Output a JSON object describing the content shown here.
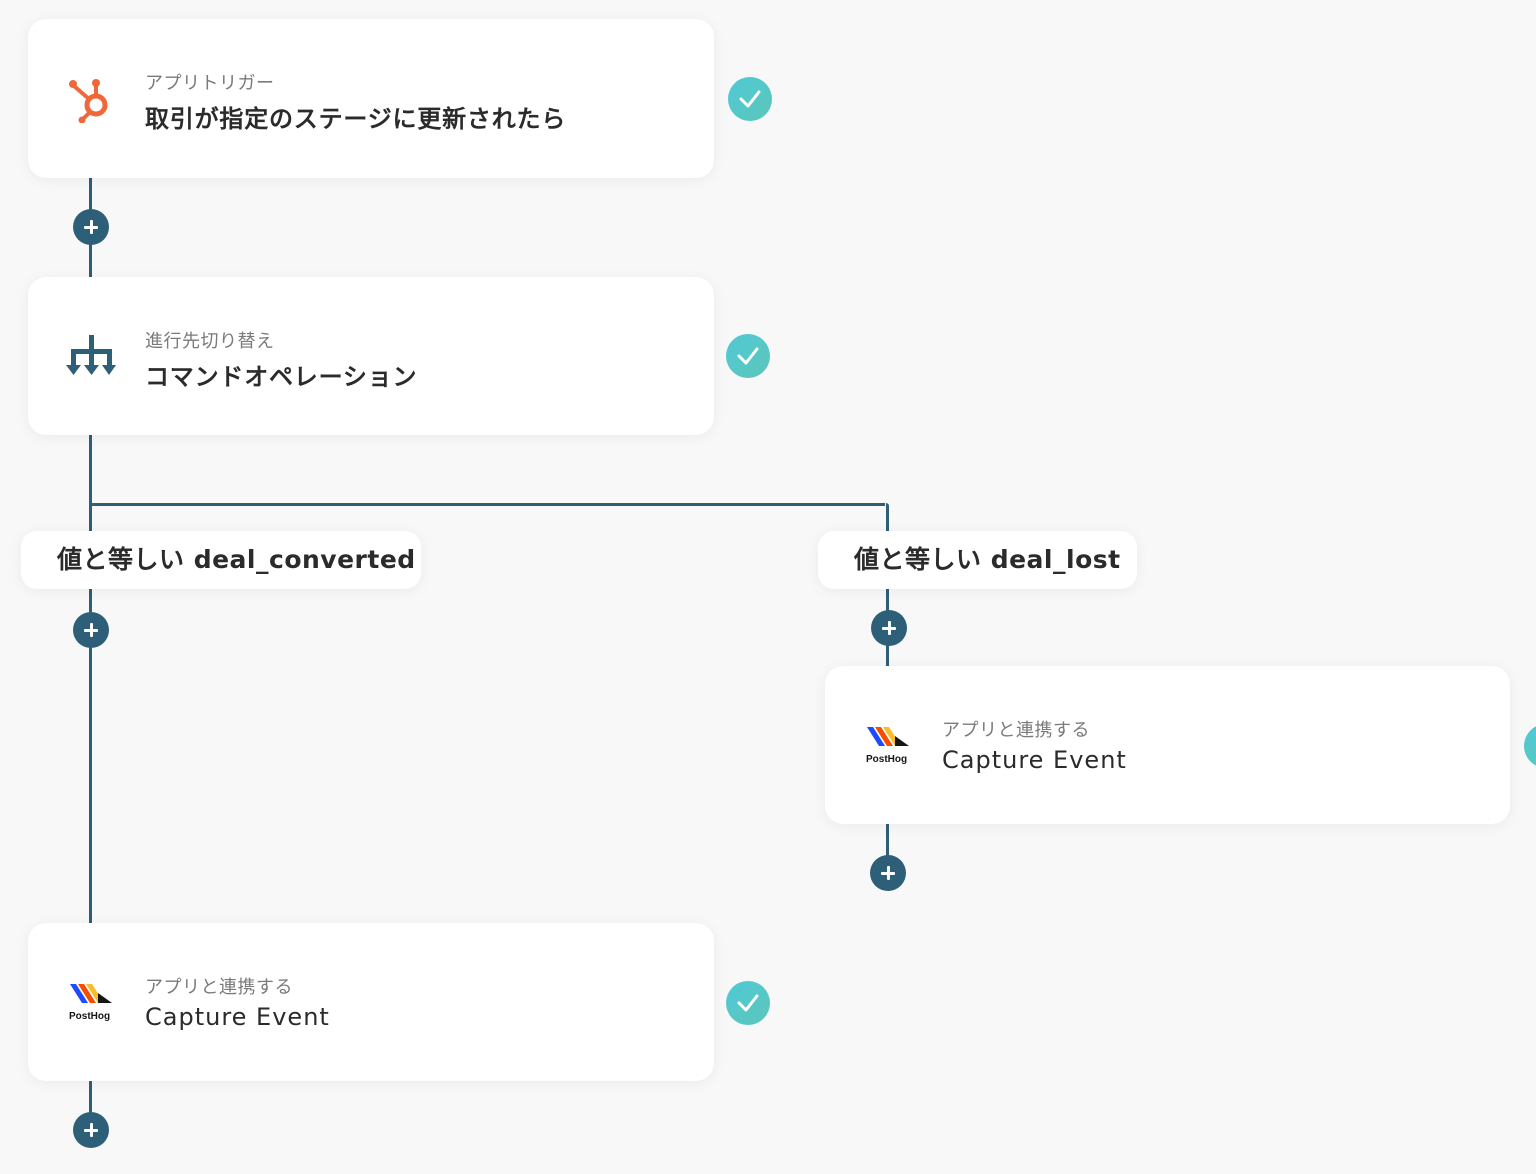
{
  "steps": [
    {
      "subtitle": "アプリトリガー",
      "title": "取引が指定のステージに更新されたら",
      "icon": "hubspot-icon",
      "status": "done"
    },
    {
      "subtitle": "進行先切り替え",
      "title": "コマンドオペレーション",
      "icon": "branch-icon",
      "status": "done"
    }
  ],
  "branches": [
    {
      "label": "値と等しい deal_converted",
      "step": {
        "subtitle": "アプリと連携する",
        "title": "Capture Event",
        "icon": "posthog-icon",
        "logo_text": "PostHog",
        "status": "done"
      }
    },
    {
      "label": "値と等しい deal_lost",
      "step": {
        "subtitle": "アプリと連携する",
        "title": "Capture Event",
        "icon": "posthog-icon",
        "logo_text": "PostHog",
        "status": "done"
      }
    }
  ],
  "colors": {
    "accent": "#2e5f78",
    "check": "#4fc9d6",
    "hubspot": "#f0683a"
  }
}
